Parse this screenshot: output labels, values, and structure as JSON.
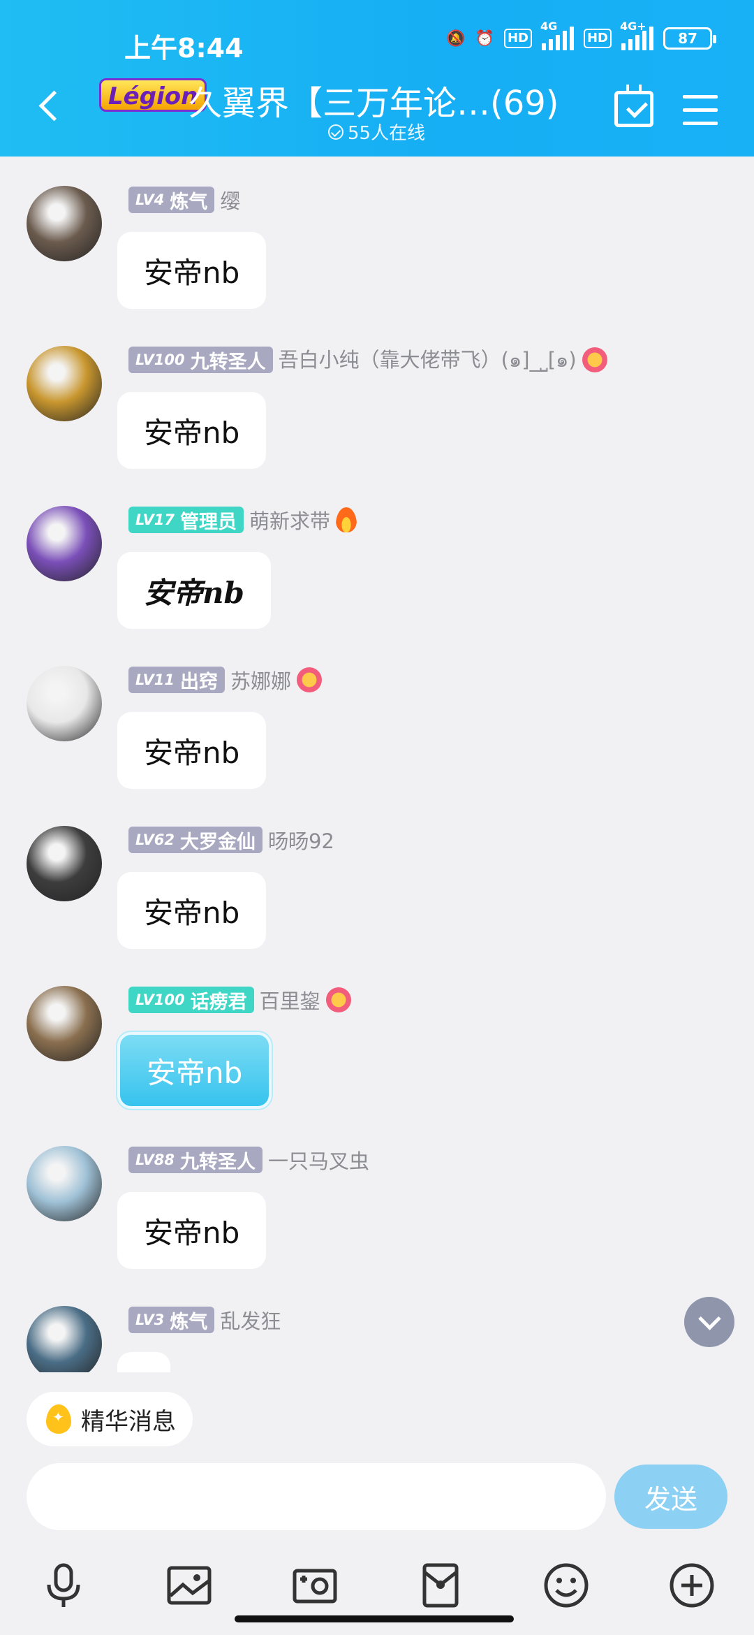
{
  "status_bar": {
    "time": "上午8:44",
    "network_1": "4G",
    "network_2": "4G+",
    "hd": "HD",
    "battery": "87"
  },
  "header": {
    "logo_text": "Légion",
    "title": "久翼界【三万年论…(69)",
    "online": "55人在线"
  },
  "messages": [
    {
      "level": "LV4",
      "rank": "炼气",
      "badge_color": "gray",
      "nick": "缨",
      "text": "安帝nb",
      "icon": "",
      "style": "normal",
      "avatar_color": "#6b5b4e"
    },
    {
      "level": "LV100",
      "rank": "九转圣人",
      "badge_color": "gray",
      "nick": "吾白小纯（靠大佬带飞）(๑]_⎵[๑)",
      "text": "安帝nb",
      "icon": "flower",
      "style": "normal",
      "avatar_color": "#c8962e"
    },
    {
      "level": "LV17",
      "rank": "管理员",
      "badge_color": "teal",
      "nick": "萌新求带",
      "text": "安帝nb",
      "icon": "fire",
      "style": "script",
      "avatar_color": "#7a4fb8"
    },
    {
      "level": "LV11",
      "rank": "出窍",
      "badge_color": "gray",
      "nick": "苏娜娜",
      "text": "安帝nb",
      "icon": "flower",
      "style": "normal",
      "avatar_color": "#e8e8e8"
    },
    {
      "level": "LV62",
      "rank": "大罗金仙",
      "badge_color": "gray",
      "nick": "旸旸92",
      "text": "安帝nb",
      "icon": "",
      "style": "normal",
      "avatar_color": "#3d3d3d"
    },
    {
      "level": "LV100",
      "rank": "话痨君",
      "badge_color": "teal",
      "nick": "百里鋆",
      "text": "安帝nb",
      "icon": "flower",
      "style": "blue",
      "avatar_color": "#8a6f4f"
    },
    {
      "level": "LV88",
      "rank": "九转圣人",
      "badge_color": "gray",
      "nick": "一只马叉虫",
      "text": "安帝nb",
      "icon": "",
      "style": "normal",
      "avatar_color": "#9fc1d6"
    },
    {
      "level": "LV3",
      "rank": "炼气",
      "badge_color": "gray",
      "nick": "乱发狂",
      "text": "",
      "icon": "",
      "style": "normal",
      "avatar_color": "#4a6d86"
    }
  ],
  "composer": {
    "essence_label": "精华消息",
    "input_value": "",
    "input_placeholder": "",
    "send_label": "发送"
  },
  "toolbar_icons": [
    "microphone-icon",
    "image-icon",
    "camera-icon",
    "red-packet-icon",
    "emoji-icon",
    "plus-icon"
  ]
}
